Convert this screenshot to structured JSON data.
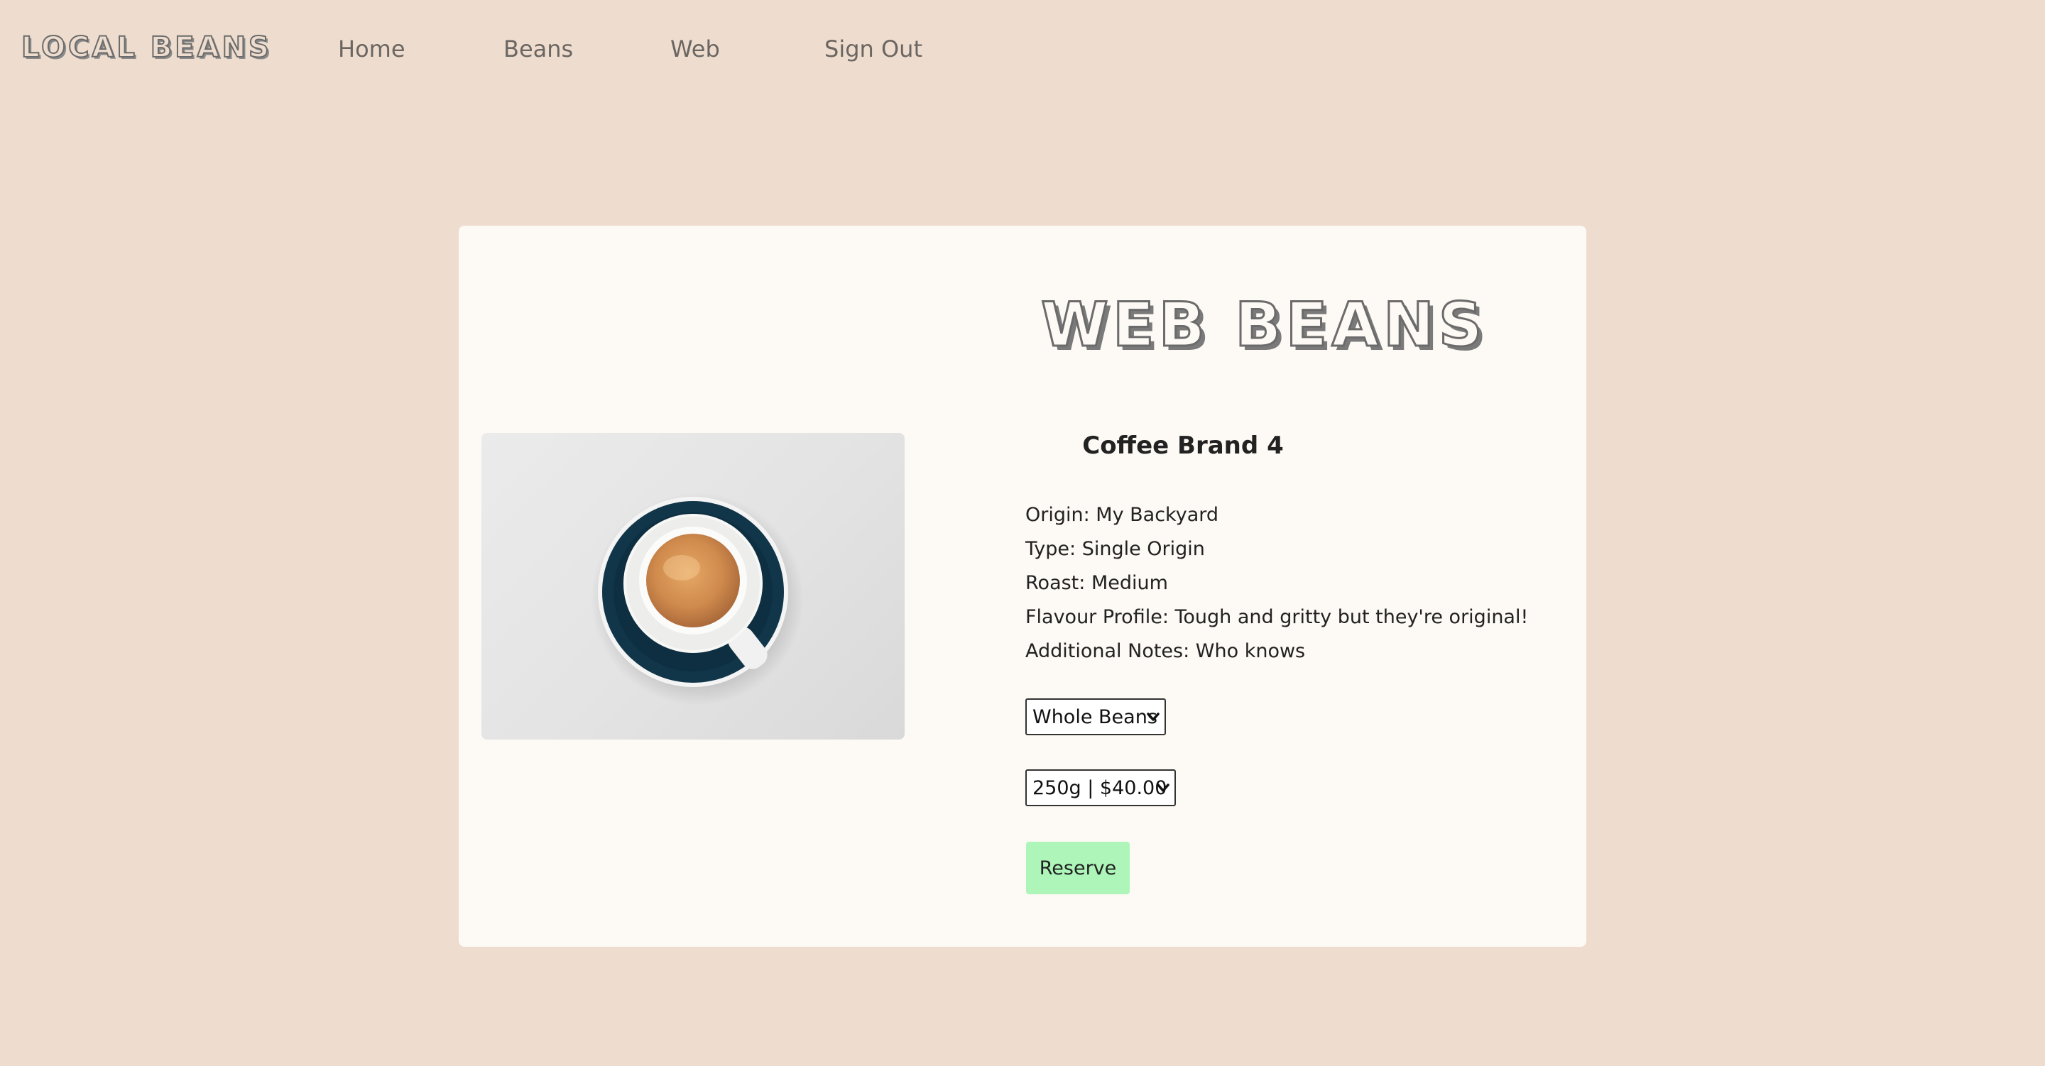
{
  "header": {
    "logo": "LOCAL BEANS",
    "nav": {
      "home": "Home",
      "beans": "Beans",
      "web": "Web",
      "sign_out": "Sign Out"
    }
  },
  "main": {
    "page_title": "WEB BEANS",
    "product": {
      "image_icon": "espresso-cup-image",
      "brand": "Coffee Brand 4",
      "details": {
        "origin": "Origin: My Backyard",
        "type": "Type: Single Origin",
        "roast": "Roast: Medium",
        "flavour": "Flavour Profile: Tough and gritty but they're original!",
        "notes": "Additional Notes: Who knows"
      },
      "grind_select": {
        "selected": "Whole Beans"
      },
      "size_select": {
        "selected": "250g | $40.00"
      },
      "reserve_label": "Reserve"
    }
  },
  "colors": {
    "background": "#eeddce",
    "card": "#fdf9f4",
    "reserve_button": "#adf5b8",
    "nav_text": "#6b6662"
  }
}
